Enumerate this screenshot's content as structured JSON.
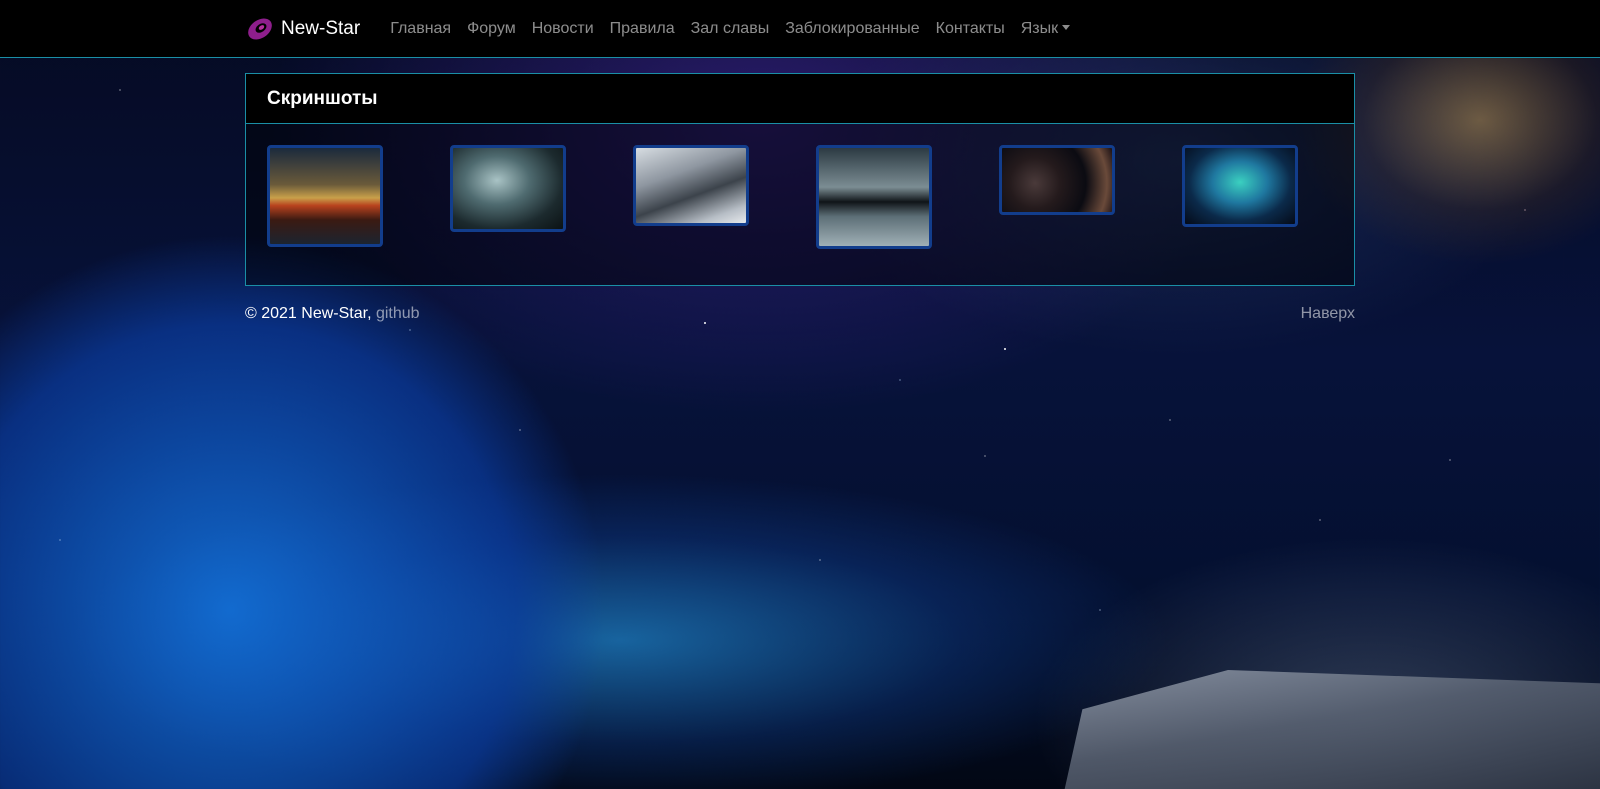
{
  "brand": {
    "name": "New-Star",
    "logo_icon": "galaxy-logo-icon",
    "logo_color": "#8e1e8c"
  },
  "nav": {
    "items": [
      {
        "label": "Главная"
      },
      {
        "label": "Форум"
      },
      {
        "label": "Новости"
      },
      {
        "label": "Правила"
      },
      {
        "label": "Зал славы"
      },
      {
        "label": "Заблокированные"
      },
      {
        "label": "Контакты"
      }
    ],
    "language_label": "Язык",
    "language_icon": "caret-down-icon"
  },
  "screenshots": {
    "title": "Скриншоты",
    "thumb_border_color": "#123d8c",
    "count": 6
  },
  "footer": {
    "copyright": "© 2021 New-Star,",
    "github_label": "github",
    "back_to_top_label": "Наверх"
  },
  "colors": {
    "accent_border": "#1a8fa6",
    "navbar_bg": "#000000",
    "muted_link": "rgba(255,255,255,0.55)"
  }
}
